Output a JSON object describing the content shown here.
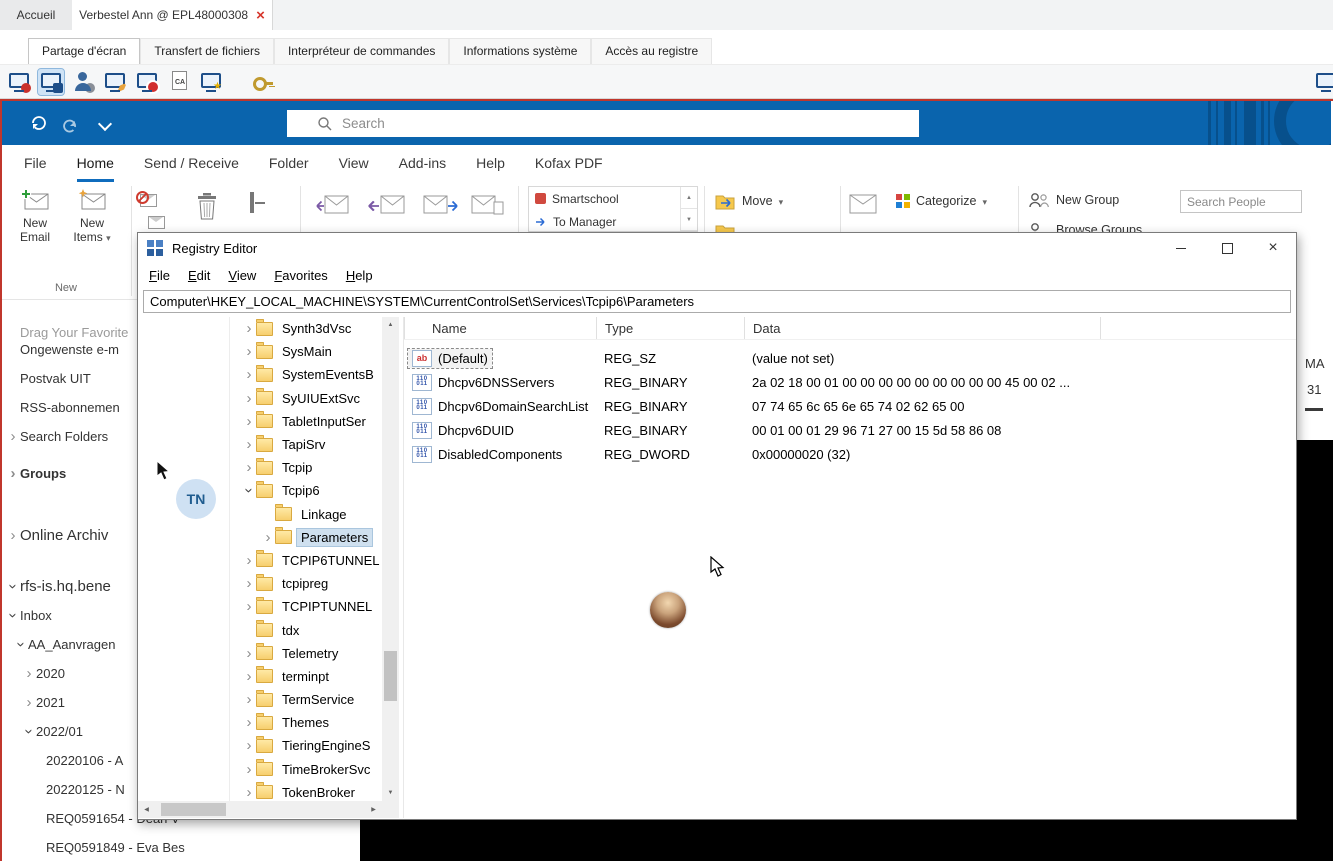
{
  "remote": {
    "tabs": [
      "Accueil",
      "Verbestel Ann @ EPL48000308"
    ],
    "nav_tabs": [
      {
        "label": "Partage d'écran",
        "state": "active"
      },
      {
        "label": "Transfert de fichiers"
      },
      {
        "label": "Interpréteur de commandes"
      },
      {
        "label": "Informations système"
      },
      {
        "label": "Accès au registre"
      }
    ],
    "toolbar_icons": [
      {
        "name": "screen-share-icon",
        "badge": "b-red"
      },
      {
        "name": "screen-lock-icon",
        "badge": "b-lock",
        "state": "active"
      },
      {
        "name": "user-settings-icon",
        "badge": "b-gear"
      },
      {
        "name": "screen-edit-icon",
        "badge": "b-pencil"
      },
      {
        "name": "screen-record-icon",
        "badge": "b-dot"
      },
      {
        "name": "ca-document-icon",
        "badge": ""
      },
      {
        "name": "screen-star-icon",
        "badge": "b-star"
      },
      {
        "name": "key-icon",
        "badge": ""
      },
      {
        "name": "remote-screen-icon",
        "badge": "",
        "pos": "right"
      }
    ]
  },
  "outlook": {
    "search_placeholder": "Search",
    "menu": [
      {
        "label": "File"
      },
      {
        "label": "Home",
        "state": "active"
      },
      {
        "label": "Send / Receive"
      },
      {
        "label": "Folder"
      },
      {
        "label": "View"
      },
      {
        "label": "Add-ins"
      },
      {
        "label": "Help"
      },
      {
        "label": "Kofax PDF"
      }
    ],
    "ribbon": {
      "new_email": "New Email",
      "new_items": "New Items",
      "group_new": "New",
      "quick_steps": [
        "Smartschool",
        "To Manager"
      ],
      "move": "Move",
      "categorize": "Categorize",
      "new_group": "New Group",
      "browse_groups": "Browse Groups",
      "search_people_placeholder": "Search People"
    },
    "sidebar": {
      "items": [
        {
          "label": "Drag Your Favorite",
          "style": "hint",
          "chev": "none",
          "indent": "ind0"
        },
        {
          "label": "Ongewenste e-m",
          "chev": "none",
          "indent": "ind0",
          "gap": "tight"
        },
        {
          "label": "Postvak UIT",
          "chev": "none",
          "indent": "ind0"
        },
        {
          "label": "RSS-abonnemen",
          "chev": "none",
          "indent": "ind0"
        },
        {
          "label": "Search Folders",
          "chev": "right",
          "indent": "ind0"
        },
        {
          "label": "Groups",
          "chev": "right",
          "style": "bold",
          "indent": "ind0",
          "gap": "mt8"
        },
        {
          "label": "Online Archiv",
          "chev": "right",
          "style": "big",
          "indent": "ind0",
          "gap": "mt33"
        },
        {
          "label": "rfs-is.hq.bene",
          "chev": "down",
          "style": "big",
          "indent": "ind0",
          "gap": "mt22"
        },
        {
          "label": "Inbox",
          "chev": "down",
          "indent": "ind0"
        },
        {
          "label": "AA_Aanvragen",
          "chev": "down",
          "indent": "ind1"
        },
        {
          "label": "2020",
          "chev": "right",
          "indent": "ind2"
        },
        {
          "label": "2021",
          "chev": "right",
          "indent": "ind2"
        },
        {
          "label": "2022/01",
          "chev": "down",
          "indent": "ind2"
        },
        {
          "label": "20220106 - A",
          "chev": "none",
          "indent": "ind3"
        },
        {
          "label": "20220125 - N",
          "chev": "none",
          "indent": "ind3"
        },
        {
          "label": "REQ0591654 - Dean V",
          "chev": "none",
          "indent": "ind3"
        },
        {
          "label": "REQ0591849 - Eva Bes",
          "chev": "none",
          "indent": "ind3"
        }
      ]
    },
    "peek": {
      "day": "MA",
      "date": "31"
    }
  },
  "regedit": {
    "title": "Registry Editor",
    "menu": [
      "File",
      "Edit",
      "View",
      "Favorites",
      "Help"
    ],
    "address": "Computer\\HKEY_LOCAL_MACHINE\\SYSTEM\\CurrentControlSet\\Services\\Tcpip6\\Parameters",
    "columns": [
      "Name",
      "Type",
      "Data"
    ],
    "tree": [
      {
        "label": "Synth3dVsc",
        "chev": "right",
        "indent": "ind0"
      },
      {
        "label": "SysMain",
        "chev": "right",
        "indent": "ind0"
      },
      {
        "label": "SystemEventsB",
        "chev": "right",
        "indent": "ind0"
      },
      {
        "label": "SyUIUExtSvc",
        "chev": "right",
        "indent": "ind0"
      },
      {
        "label": "TabletInputSer",
        "chev": "right",
        "indent": "ind0"
      },
      {
        "label": "TapiSrv",
        "chev": "right",
        "indent": "ind0"
      },
      {
        "label": "Tcpip",
        "chev": "right",
        "indent": "ind0"
      },
      {
        "label": "Tcpip6",
        "chev": "down",
        "indent": "ind0"
      },
      {
        "label": "Linkage",
        "chev": "none",
        "indent": "ind1"
      },
      {
        "label": "Parameters",
        "chev": "right",
        "indent": "ind1",
        "state": "selected"
      },
      {
        "label": "TCPIP6TUNNEL",
        "chev": "right",
        "indent": "ind0"
      },
      {
        "label": "tcpipreg",
        "chev": "right",
        "indent": "ind0"
      },
      {
        "label": "TCPIPTUNNEL",
        "chev": "right",
        "indent": "ind0"
      },
      {
        "label": "tdx",
        "chev": "none",
        "indent": "ind0"
      },
      {
        "label": "Telemetry",
        "chev": "right",
        "indent": "ind0"
      },
      {
        "label": "terminpt",
        "chev": "right",
        "indent": "ind0"
      },
      {
        "label": "TermService",
        "chev": "right",
        "indent": "ind0"
      },
      {
        "label": "Themes",
        "chev": "right",
        "indent": "ind0"
      },
      {
        "label": "TieringEngineS",
        "chev": "right",
        "indent": "ind0"
      },
      {
        "label": "TimeBrokerSvc",
        "chev": "right",
        "indent": "ind0"
      },
      {
        "label": "TokenBroker",
        "chev": "right",
        "indent": "ind0"
      }
    ],
    "values": [
      {
        "name": "(Default)",
        "type": "REG_SZ",
        "data": "(value not set)",
        "icon": "string",
        "state": "selected"
      },
      {
        "name": "Dhcpv6DNSServers",
        "type": "REG_BINARY",
        "data": "2a 02 18 00 01 00 00 00 00 00 00 00 00 00 45 00 02 ...",
        "icon": "binary"
      },
      {
        "name": "Dhcpv6DomainSearchList",
        "type": "REG_BINARY",
        "data": "07 74 65 6c 65 6e 65 74 02 62 65 00",
        "icon": "binary"
      },
      {
        "name": "Dhcpv6DUID",
        "type": "REG_BINARY",
        "data": "00 01 00 01 29 96 71 27 00 15 5d 58 86 08",
        "icon": "binary"
      },
      {
        "name": "DisabledComponents",
        "type": "REG_DWORD",
        "data": "0x00000020 (32)",
        "icon": "binary"
      }
    ]
  },
  "avatars": {
    "initials": "TN"
  }
}
